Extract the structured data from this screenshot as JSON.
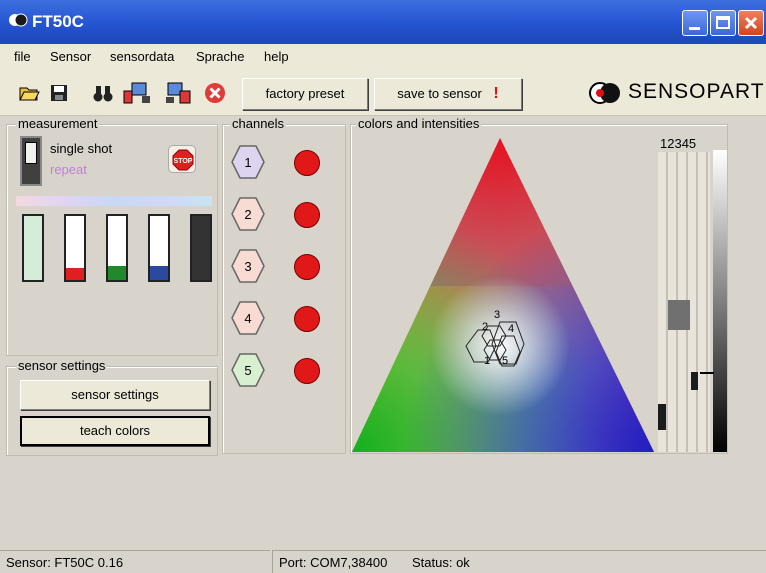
{
  "window": {
    "title": "FT50C"
  },
  "menu": [
    "file",
    "Sensor",
    "sensordata",
    "Sprache",
    "help"
  ],
  "toolbar": {
    "factory_preset": "factory preset",
    "save_to_sensor": "save to sensor",
    "save_marker": "!",
    "brand": "SENSOPART"
  },
  "measurement": {
    "label": "measurement",
    "single_shot": "single shot",
    "repeat": "repeat",
    "stop": "STOP",
    "level_bars": [
      {
        "color": "#d4ecd8",
        "level": 1.0
      },
      {
        "color": "#e02020",
        "level": 0.18
      },
      {
        "color": "#1f8a2a",
        "level": 0.22
      },
      {
        "color": "#2a4aa0",
        "level": 0.22
      },
      {
        "color": "#333333",
        "level": 1.0
      }
    ]
  },
  "sensor_settings": {
    "label": "sensor settings",
    "settings_button": "sensor settings",
    "teach_button": "teach colors"
  },
  "channels": {
    "label": "channels",
    "items": [
      {
        "number": "1",
        "fill": "#ddd4f0",
        "led": "#e01818"
      },
      {
        "number": "2",
        "fill": "#f8dcd4",
        "led": "#e01818"
      },
      {
        "number": "3",
        "fill": "#f8dcd4",
        "led": "#e01818"
      },
      {
        "number": "4",
        "fill": "#f8dcd4",
        "led": "#e01818"
      },
      {
        "number": "5",
        "fill": "#d8f0d0",
        "led": "#e01818"
      }
    ]
  },
  "colors": {
    "label": "colors and intensities",
    "intensity_header": "12345",
    "markers": [
      "1",
      "2",
      "3",
      "4",
      "5"
    ]
  },
  "statusbar": {
    "sensor": "Sensor: FT50C 0.16",
    "port": "Port: COM7,38400",
    "status": "Status: ok"
  }
}
